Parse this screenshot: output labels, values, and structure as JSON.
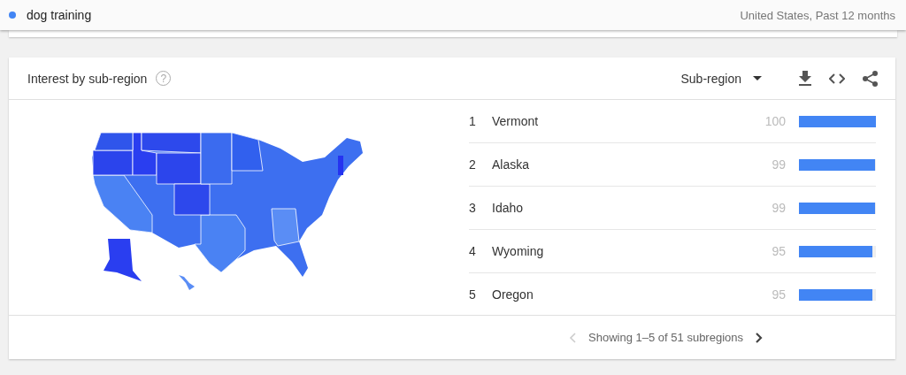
{
  "search_term": {
    "label": "dog training",
    "color": "#4285f4"
  },
  "scope": "United States, Past 12 months",
  "card": {
    "title": "Interest by sub-region",
    "help": "?",
    "resolution": "Sub-region",
    "rows": [
      {
        "rank": "1",
        "name": "Vermont",
        "value": "100",
        "level": 1.0
      },
      {
        "rank": "2",
        "name": "Alaska",
        "value": "99",
        "level": 0.99
      },
      {
        "rank": "3",
        "name": "Idaho",
        "value": "99",
        "level": 0.99
      },
      {
        "rank": "4",
        "name": "Wyoming",
        "value": "95",
        "level": 0.95
      },
      {
        "rank": "5",
        "name": "Oregon",
        "value": "95",
        "level": 0.95
      }
    ],
    "pagination": {
      "text": "Showing 1–5 of 51 subregions",
      "prev_disabled": true,
      "next_disabled": false
    }
  }
}
